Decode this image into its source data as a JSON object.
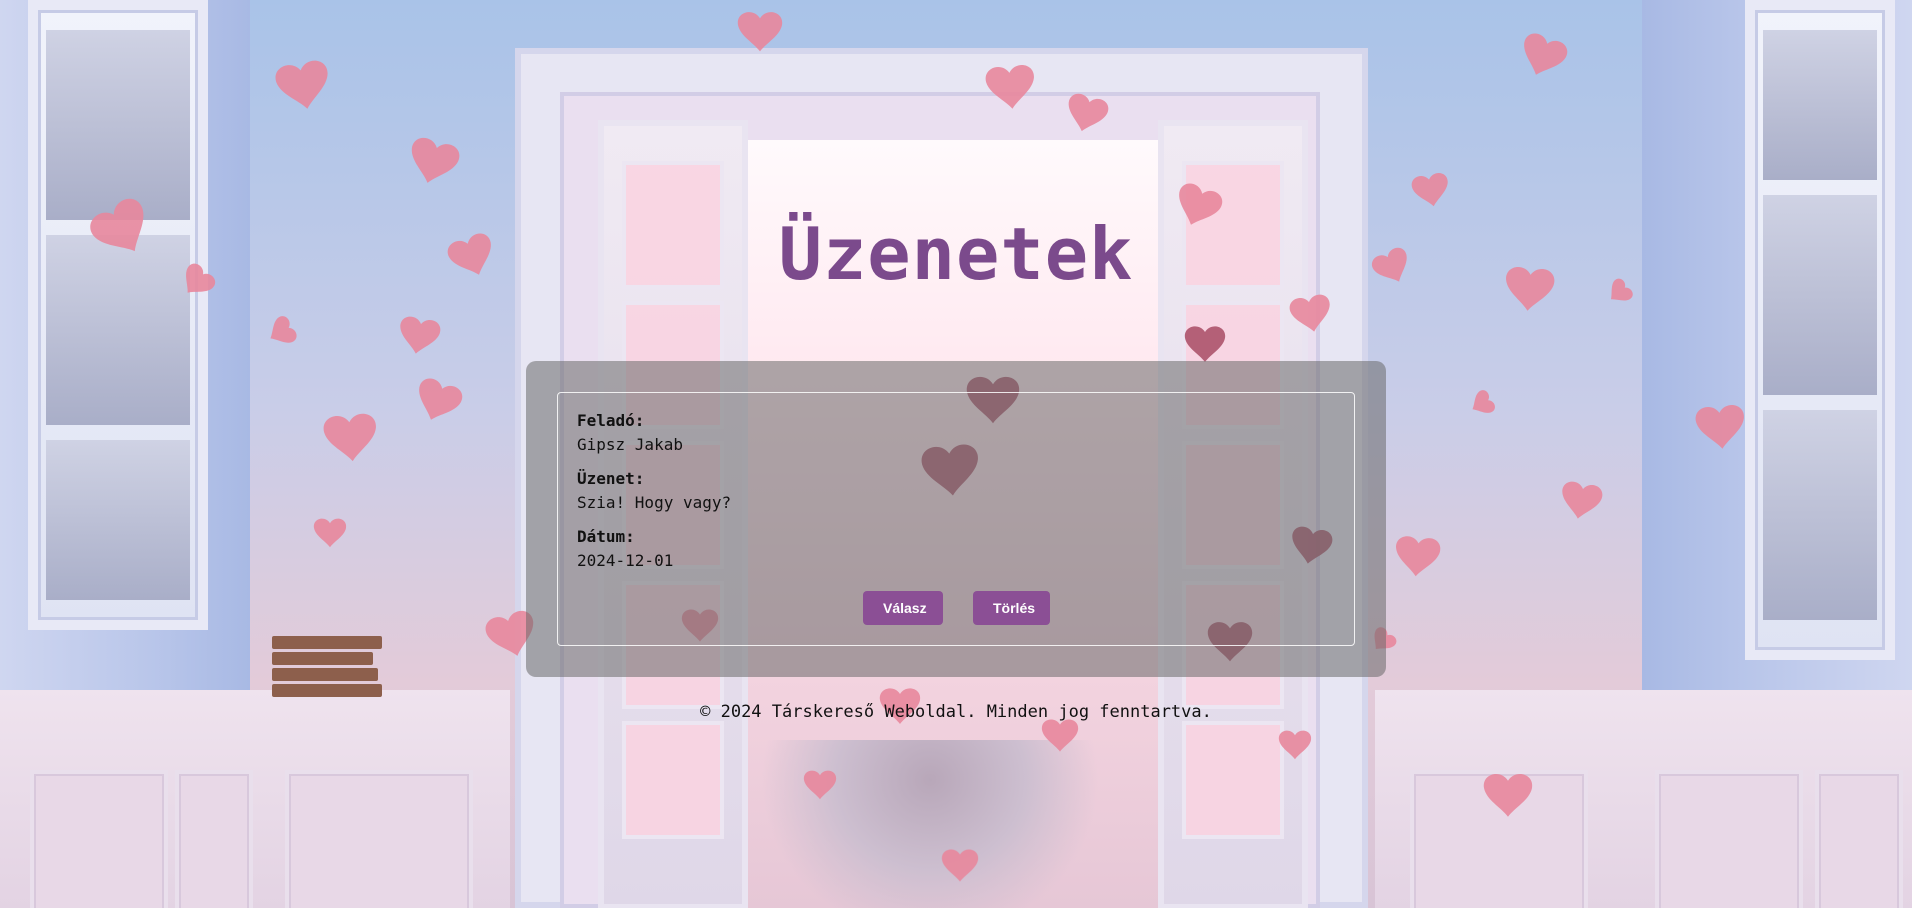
{
  "page": {
    "title": "Üzenetek"
  },
  "message": {
    "sender_label": "Feladó:",
    "sender": "Gipsz Jakab",
    "text_label": "Üzenet:",
    "text": "Szia! Hogy vagy?",
    "date_label": "Dátum:",
    "date": "2024-12-01"
  },
  "actions": {
    "reply_label": "Válasz",
    "delete_label": "Törlés"
  },
  "footer": {
    "copyright": "© 2024 Társkereső Weboldal. Minden jog fenntartva."
  },
  "colors": {
    "accent": "#8b4f95",
    "title": "#7b4a8c",
    "panel_overlay": "rgba(105,105,105,0.55)"
  }
}
